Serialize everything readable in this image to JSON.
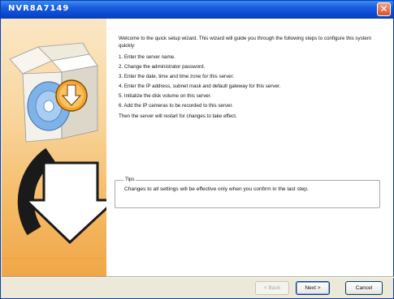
{
  "window": {
    "title": "NVR8A7149",
    "close_symbol": "✕"
  },
  "content": {
    "intro": "Welcome to the quick setup wizard. This wizard will guide you through the following steps to configure this system quickly:",
    "steps": [
      "1. Enter the server name.",
      "2. Change the administrator password.",
      "3. Enter the date, time and time zone for this server.",
      "4. Enter the IP address, subnet mask and default gateway for this server.",
      "5. Initialize the disk volume on this server.",
      "6. Add the IP cameras to be recorded to this server."
    ],
    "restart_note": "Then the server will restart for changes to take effect.",
    "tips": {
      "title": "Tips",
      "text": "Changes to all settings will be effective only when you confirm in the last step."
    }
  },
  "buttons": {
    "back": "< Back",
    "next": "Next >",
    "cancel": "Cancel"
  },
  "icons": {
    "wizard_illustration": "software-box-download-icon",
    "accent": "#f0a648",
    "title_bar": "#0a4bd4"
  }
}
